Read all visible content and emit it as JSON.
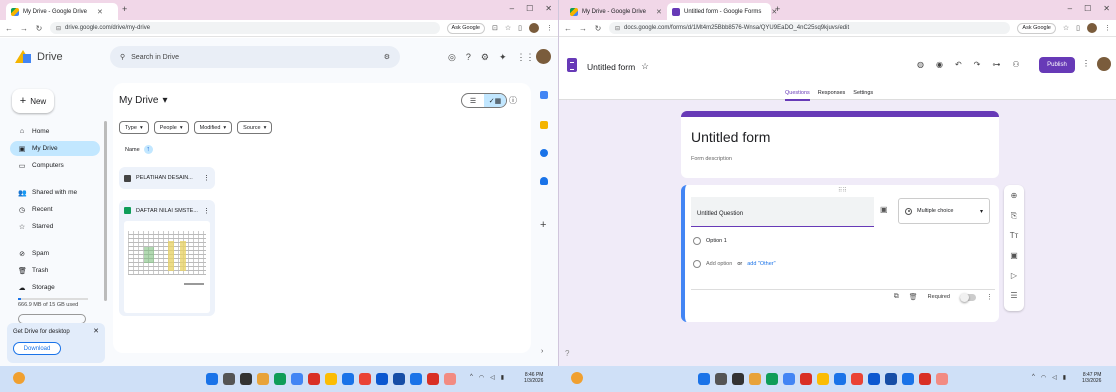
{
  "left_browser": {
    "tab_title": "My Drive - Google Drive",
    "url": "drive.google.com/drive/my-drive",
    "ask_label": "Ask Google"
  },
  "right_browser": {
    "tab1_title": "My Drive - Google Drive",
    "tab2_title": "Untitled form - Google Forms",
    "url": "docs.google.com/forms/d/1Mt4m25Bbb8576-Wnsa/QYU9EaDO_4nC25sq9kjuvs/edit",
    "ask_label": "Ask Google"
  },
  "drive": {
    "app_name": "Drive",
    "search_placeholder": "Search in Drive",
    "new_label": "New",
    "nav": [
      {
        "icon": "home-icon",
        "glyph": "⌂",
        "label": "Home"
      },
      {
        "icon": "my-drive-icon",
        "glyph": "▣",
        "label": "My Drive"
      },
      {
        "icon": "computers-icon",
        "glyph": "▭",
        "label": "Computers"
      },
      {
        "icon": "shared-icon",
        "glyph": "👥",
        "label": "Shared with me"
      },
      {
        "icon": "recent-icon",
        "glyph": "◷",
        "label": "Recent"
      },
      {
        "icon": "star-icon",
        "glyph": "☆",
        "label": "Starred"
      },
      {
        "icon": "spam-icon",
        "glyph": "⊘",
        "label": "Spam"
      },
      {
        "icon": "trash-icon",
        "glyph": "🗑",
        "label": "Trash"
      },
      {
        "icon": "cloud-icon",
        "glyph": "☁",
        "label": "Storage"
      }
    ],
    "storage_text": "666.9 MB of 15 GB used",
    "storage_used_fraction": 0.04,
    "promo_text": "Get Drive for desktop",
    "promo_button": "Download",
    "main_title": "My Drive",
    "filters": [
      "Type",
      "People",
      "Modified",
      "Source"
    ],
    "sort_label": "Name",
    "folder_name": "PELATIHAN DESAIN...",
    "file_name": "DAFTAR NILAI SMSTE..."
  },
  "forms": {
    "title": "Untitled form",
    "publish_label": "Publish",
    "tabs": [
      "Questions",
      "Responses",
      "Settings"
    ],
    "form_title": "Untitled form",
    "form_description": "Form description",
    "question_text": "Untitled Question",
    "question_type": "Multiple choice",
    "option1": "Option 1",
    "add_option": "Add option",
    "or_label": "or",
    "add_other": "add \"Other\"",
    "required_label": "Required"
  },
  "taskbar": {
    "left_time": "8:46 PM",
    "left_date": "1/3/2026",
    "right_time": "8:47 PM",
    "right_date": "1/3/2026"
  }
}
